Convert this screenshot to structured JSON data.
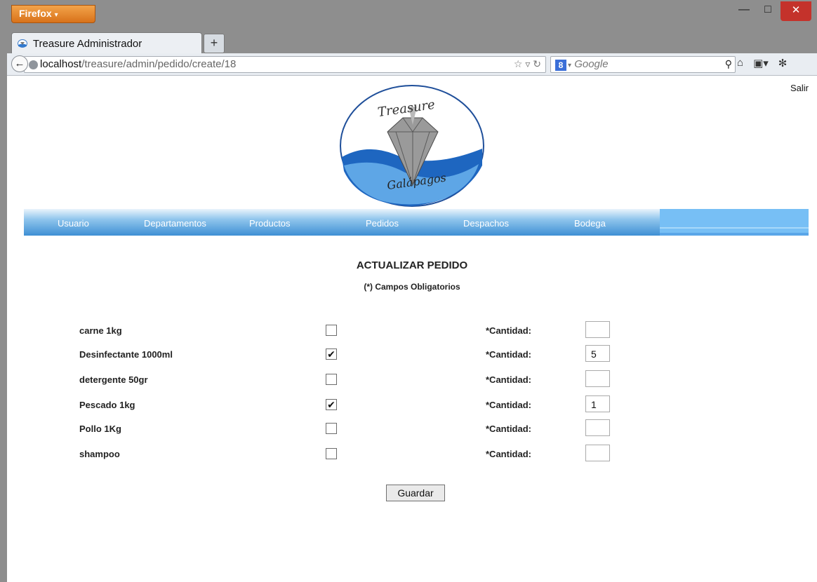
{
  "browser": {
    "app_button": "Firefox",
    "tab_title": "Treasure Administrador",
    "url_host": "localhost",
    "url_path": "/treasure/admin/pedido/create/18",
    "search_placeholder": "Google"
  },
  "page": {
    "logout": "Salir",
    "menu": [
      "Usuario",
      "Departamentos",
      "Productos",
      "Pedidos",
      "Despachos",
      "Bodega"
    ],
    "title": "ACTUALIZAR PEDIDO",
    "subtitle": "(*) Campos Obligatorios",
    "quantity_label": "*Cantidad:",
    "save_label": "Guardar",
    "products": [
      {
        "name": "carne 1kg",
        "checked": false,
        "quantity": ""
      },
      {
        "name": "Desinfectante 1000ml",
        "checked": true,
        "quantity": "5"
      },
      {
        "name": "detergente 50gr",
        "checked": false,
        "quantity": ""
      },
      {
        "name": "Pescado 1kg",
        "checked": true,
        "quantity": "1"
      },
      {
        "name": "Pollo 1Kg",
        "checked": false,
        "quantity": ""
      },
      {
        "name": "shampoo",
        "checked": false,
        "quantity": ""
      }
    ]
  },
  "colors": {
    "menu_gradient_bottom": "#3e8fd4",
    "menu_right": "#77bff5",
    "firefox_orange": "#e88a2c"
  }
}
